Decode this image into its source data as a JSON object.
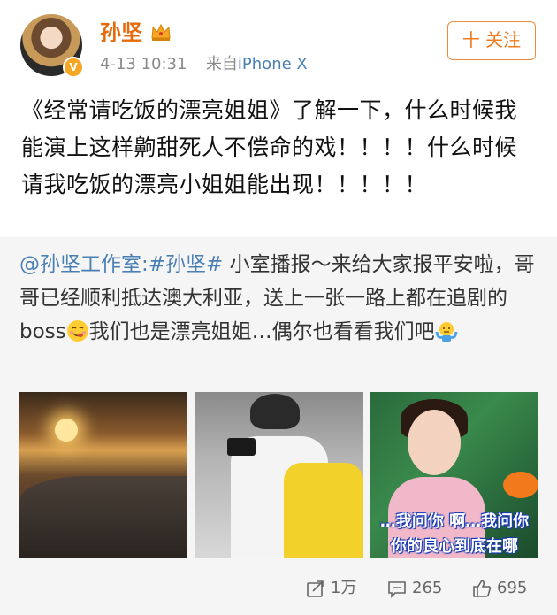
{
  "post": {
    "username": "孙坚",
    "time": "4-13 10:31",
    "source_prefix": "来自",
    "source": "iPhone X",
    "follow_label": "十 关注",
    "text": "《经常请吃饭的漂亮姐姐》了解一下，什么时候我能演上这样齁甜死人不偿命的戏！！！！什么时候请我吃饭的漂亮小姐姐能出现！！！！！"
  },
  "repost": {
    "author": "@孙坚工作室",
    "colon": ":",
    "hashtag": "#孙坚#",
    "text_part1": " 小室播报～来给大家报平安啦，哥哥已经顺利抵达澳大利亚，送上一张一路上都在追剧的boss",
    "text_part2": "我们也是漂亮姐姐…偶尔也看看我们吧",
    "subtitle_line1": "…我问你 啊…我问你",
    "subtitle_line2": "你的良心到底在哪"
  },
  "actions": {
    "repost_count": "1万",
    "comment_count": "265",
    "like_count": "695"
  },
  "colors": {
    "username": "#e46b0c",
    "link": "#4a7fb4",
    "follow_border": "#f08a3c",
    "repost_bg": "#f5f5f5"
  },
  "icons": [
    "verified-badge-icon",
    "crown-icon",
    "repost-icon",
    "comment-icon",
    "like-icon",
    "yum-emoji-icon",
    "shrug-emoji-icon"
  ]
}
